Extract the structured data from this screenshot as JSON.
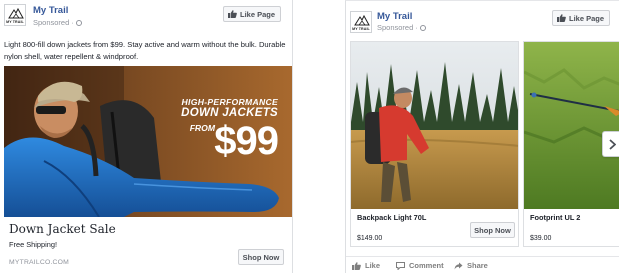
{
  "colors": {
    "page_name": "#365899",
    "secondary_text": "#90949c",
    "button_bg": "#f6f7f9",
    "button_border": "#ced0d4",
    "jacket_blue": "#1f6fc0",
    "jacket_red": "#d63a2f"
  },
  "left_ad": {
    "logo_text": "MY TRAIL",
    "page_name": "My Trail",
    "sponsored": "Sponsored ·",
    "like_page_label": "Like Page",
    "body_text": "Light 800-fill down jackets from $99. Stay active and warm without the bulk. Durable nylon shell, water repellent & windproof.",
    "hero": {
      "headline_line1": "HIGH-PERFORMANCE",
      "headline_line2": "DOWN JACKETS",
      "from_label": "FROM",
      "price": "$99"
    },
    "link": {
      "title": "Down Jacket Sale",
      "description": "Free Shipping!",
      "domain": "MYTRAILCO.COM",
      "cta_label": "Shop Now"
    }
  },
  "right_ad": {
    "logo_text": "MY TRAIL",
    "page_name": "My Trail",
    "sponsored": "Sponsored ·",
    "like_page_label": "Like Page",
    "cards": [
      {
        "title": "Backpack Light 70L",
        "price": "$149.00",
        "cta_label": "Shop Now"
      },
      {
        "title": "Footprint UL 2",
        "price": "$39.00"
      }
    ],
    "actions": {
      "like": "Like",
      "comment": "Comment",
      "share": "Share"
    }
  }
}
